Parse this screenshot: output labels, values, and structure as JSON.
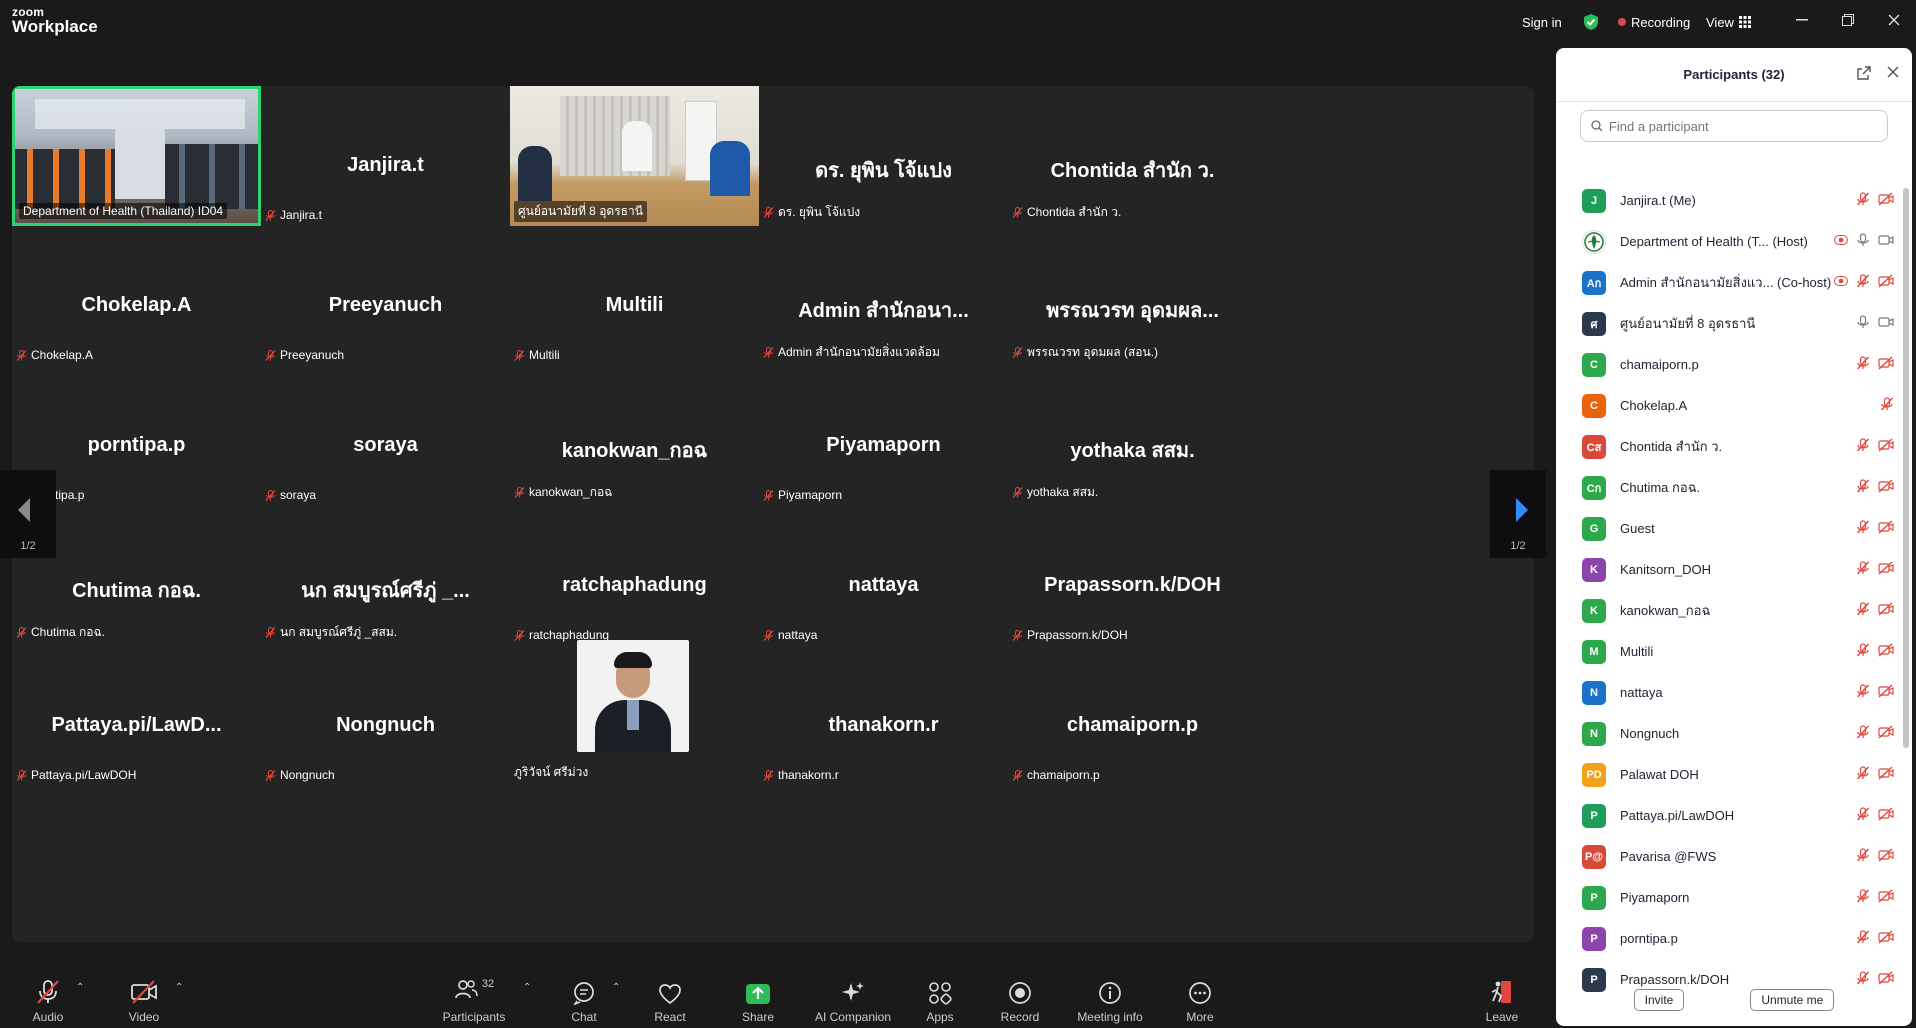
{
  "app": {
    "logo_line1": "zoom",
    "logo_line2": "Workplace"
  },
  "titlebar": {
    "sign_in": "Sign in",
    "recording": "Recording",
    "view": "View"
  },
  "gallery": {
    "tiles": [
      {
        "name": "",
        "label": "Department of Health (Thailand) ID04",
        "video": true,
        "active": true
      },
      {
        "name": "Janjira.t",
        "label": "Janjira.t"
      },
      {
        "name": "",
        "label": "ศูนย์อนามัยที่ 8 อุดรธานี",
        "video": true
      },
      {
        "name": "ดร. ยุพิน โจ้แปง",
        "label": "ดร. ยุพิน โจ้แปง"
      },
      {
        "name": "Chontida สำนัก ว.",
        "label": "Chontida สำนัก ว."
      },
      {
        "name": "Chokelap.A",
        "label": "Chokelap.A"
      },
      {
        "name": "Preeyanuch",
        "label": "Preeyanuch"
      },
      {
        "name": "Multili",
        "label": "Multili"
      },
      {
        "name": "Admin สำนักอนา...",
        "label": "Admin สำนักอนามัยสิ่งแวดล้อม"
      },
      {
        "name": "พรรณวรท อุดมผล...",
        "label": "พรรณวรท อุดมผล (สอน.)"
      },
      {
        "name": "porntipa.p",
        "label": "porntipa.p"
      },
      {
        "name": "soraya",
        "label": "soraya"
      },
      {
        "name": "kanokwan_กอฉ",
        "label": "kanokwan_กอฉ"
      },
      {
        "name": "Piyamaporn",
        "label": "Piyamaporn"
      },
      {
        "name": "yothaka สสม.",
        "label": "yothaka สสม."
      },
      {
        "name": "Chutima กอฉ.",
        "label": "Chutima กอฉ."
      },
      {
        "name": "นก สมบูรณ์ศรีภู่ _...",
        "label": "นก สมบูรณ์ศรีภู่ _สสม."
      },
      {
        "name": "ratchaphadung",
        "label": "ratchaphadung"
      },
      {
        "name": "nattaya",
        "label": "nattaya"
      },
      {
        "name": "Prapassorn.k/DOH",
        "label": "Prapassorn.k/DOH"
      },
      {
        "name": "Pattaya.pi/LawD...",
        "label": "Pattaya.pi/LawDOH"
      },
      {
        "name": "Nongnuch",
        "label": "Nongnuch"
      },
      {
        "name": "",
        "label": "ภูริวัจน์ ศรีม่วง",
        "photo": true
      },
      {
        "name": "thanakorn.r",
        "label": "thanakorn.r"
      },
      {
        "name": "chamaiporn.p",
        "label": "chamaiporn.p"
      }
    ],
    "page_left": "1/2",
    "page_right": "1/2"
  },
  "toolbar": {
    "audio": "Audio",
    "video": "Video",
    "participants": "Participants",
    "participants_count": "32",
    "chat": "Chat",
    "react": "React",
    "share": "Share",
    "ai_companion": "AI Companion",
    "apps": "Apps",
    "record": "Record",
    "meeting_info": "Meeting info",
    "more": "More",
    "leave": "Leave"
  },
  "panel": {
    "title": "Participants (32)",
    "search_placeholder": "Find a participant",
    "invite": "Invite",
    "unmute_me": "Unmute me",
    "participants": [
      {
        "initials": "J",
        "color": "#1f9e5a",
        "name": "Janjira.t (Me)",
        "mic": "muted",
        "cam": "off"
      },
      {
        "initials": "",
        "color": "#ffffff",
        "name": "Department of Health (T...  (Host)",
        "logo": true,
        "rec": true,
        "mic": "on",
        "cam": "on"
      },
      {
        "initials": "Aก",
        "color": "#1a73c8",
        "name": "Admin สำนักอนามัยสิ่งแว... (Co-host)",
        "rec": true,
        "mic": "muted",
        "cam": "off"
      },
      {
        "initials": "ศ",
        "color": "#2b3a4a",
        "name": "ศูนย์อนามัยที่ 8 อุดรธานี",
        "mic": "on",
        "cam": "on"
      },
      {
        "initials": "C",
        "color": "#2ea84d",
        "name": "chamaiporn.p",
        "mic": "muted",
        "cam": "off"
      },
      {
        "initials": "C",
        "color": "#e8630a",
        "name": "Chokelap.A",
        "mic": "muted",
        "cam": "none"
      },
      {
        "initials": "Cส",
        "color": "#d9493a",
        "name": "Chontida สำนัก ว.",
        "mic": "muted",
        "cam": "off"
      },
      {
        "initials": "Cก",
        "color": "#2ea84d",
        "name": "Chutima กอฉ.",
        "mic": "muted",
        "cam": "off"
      },
      {
        "initials": "G",
        "color": "#2ea84d",
        "name": "Guest",
        "mic": "muted",
        "cam": "off"
      },
      {
        "initials": "K",
        "color": "#8e44ad",
        "name": "Kanitsorn_DOH",
        "mic": "muted",
        "cam": "off"
      },
      {
        "initials": "K",
        "color": "#2ea84d",
        "name": "kanokwan_กอฉ",
        "mic": "muted",
        "cam": "off"
      },
      {
        "initials": "M",
        "color": "#2ea84d",
        "name": "Multili",
        "mic": "muted",
        "cam": "off"
      },
      {
        "initials": "N",
        "color": "#1a73c8",
        "name": "nattaya",
        "mic": "muted",
        "cam": "off"
      },
      {
        "initials": "N",
        "color": "#2ea84d",
        "name": "Nongnuch",
        "mic": "muted",
        "cam": "off"
      },
      {
        "initials": "PD",
        "color": "#f0a21c",
        "name": "Palawat DOH",
        "mic": "muted",
        "cam": "off"
      },
      {
        "initials": "P",
        "color": "#1f9e5a",
        "name": "Pattaya.pi/LawDOH",
        "mic": "muted",
        "cam": "off"
      },
      {
        "initials": "P@",
        "color": "#d9493a",
        "name": "Pavarisa @FWS",
        "mic": "muted",
        "cam": "off"
      },
      {
        "initials": "P",
        "color": "#2ea84d",
        "name": "Piyamaporn",
        "mic": "muted",
        "cam": "off"
      },
      {
        "initials": "P",
        "color": "#8e44ad",
        "name": "porntipa.p",
        "mic": "muted",
        "cam": "off"
      },
      {
        "initials": "P",
        "color": "#2b3a4a",
        "name": "Prapassorn.k/DOH",
        "mic": "muted",
        "cam": "off"
      }
    ]
  }
}
